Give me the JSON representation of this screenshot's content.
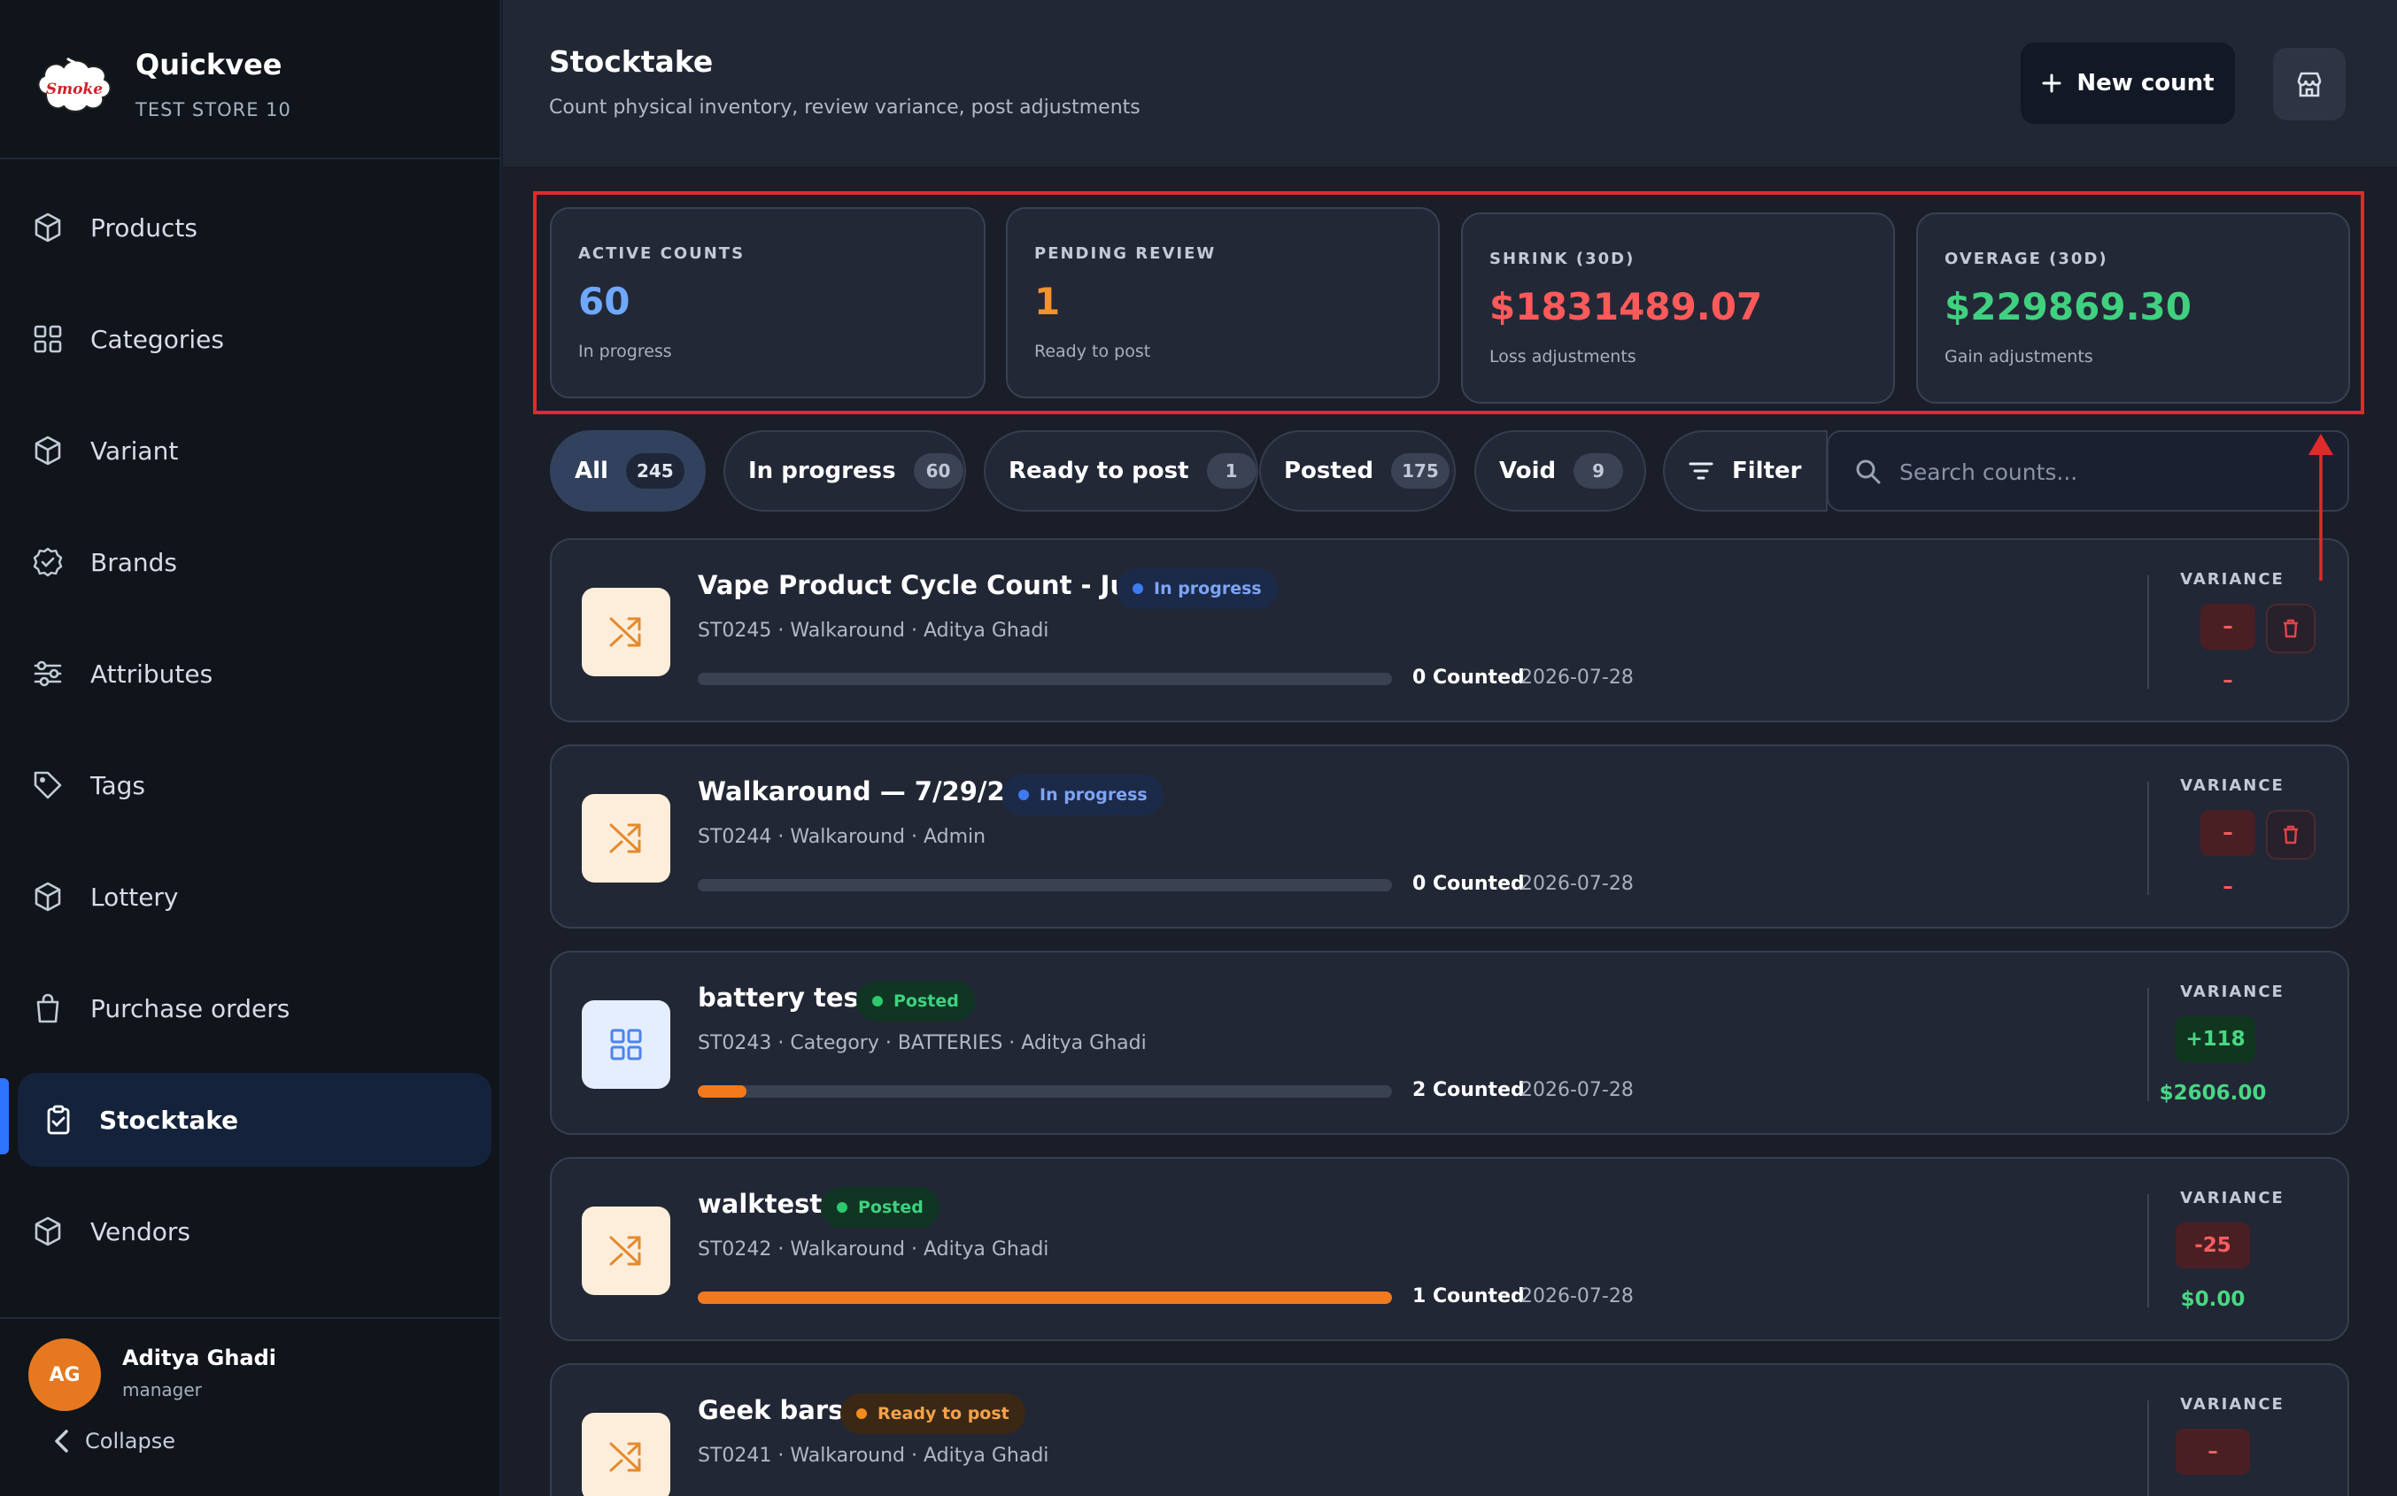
{
  "brand": {
    "name": "Quickvee",
    "store": "TEST STORE 10",
    "logo_text": "Smoke"
  },
  "nav": [
    {
      "label": "Products",
      "icon": "box-icon"
    },
    {
      "label": "Categories",
      "icon": "grid-icon"
    },
    {
      "label": "Variant",
      "icon": "box-icon"
    },
    {
      "label": "Brands",
      "icon": "badge-check-icon"
    },
    {
      "label": "Attributes",
      "icon": "sliders-icon"
    },
    {
      "label": "Tags",
      "icon": "tag-icon"
    },
    {
      "label": "Lottery",
      "icon": "box-icon"
    },
    {
      "label": "Purchase orders",
      "icon": "shopping-bag-icon"
    },
    {
      "label": "Stocktake",
      "icon": "clipboard-check-icon",
      "active": true
    },
    {
      "label": "Vendors",
      "icon": "box-icon"
    }
  ],
  "user": {
    "initials": "AG",
    "name": "Aditya Ghadi",
    "role": "manager",
    "collapse_label": "Collapse"
  },
  "header": {
    "title": "Stocktake",
    "subtitle": "Count physical inventory, review variance, post adjustments",
    "new_count_label": "New count"
  },
  "stats": [
    {
      "label": "ACTIVE COUNTS",
      "value": "60",
      "sub": "In progress",
      "color": "#6ea8ff"
    },
    {
      "label": "PENDING REVIEW",
      "value": "1",
      "sub": "Ready to post",
      "color": "#f5922b"
    },
    {
      "label": "SHRINK (30D)",
      "value": "$1831489.07",
      "sub": "Loss adjustments",
      "color": "#ff5a5a"
    },
    {
      "label": "OVERAGE (30D)",
      "value": "$229869.30",
      "sub": "Gain adjustments",
      "color": "#3fd17f"
    }
  ],
  "filters": {
    "chips": [
      {
        "label": "All",
        "count": "245",
        "active": true
      },
      {
        "label": "In progress",
        "count": "60"
      },
      {
        "label": "Ready to post",
        "count": "1"
      },
      {
        "label": "Posted",
        "count": "175"
      },
      {
        "label": "Void",
        "count": "9"
      }
    ],
    "filter_label": "Filter",
    "search_placeholder": "Search counts..."
  },
  "counts": [
    {
      "title": "Vape Product Cycle Count - July",
      "status": "In progress",
      "status_kind": "inprog",
      "meta": "ST0245 · Walkaround · Aditya Ghadi",
      "progress": 0,
      "counted": "0 Counted",
      "date": "2026-07-28",
      "variance_label": "VARIANCE",
      "variance": "–",
      "amount": "–",
      "icon": "shuffle-icon"
    },
    {
      "title": "Walkaround — 7/29/2026",
      "status": "In progress",
      "status_kind": "inprog",
      "meta": "ST0244 · Walkaround · Admin",
      "progress": 0,
      "counted": "0 Counted",
      "date": "2026-07-28",
      "variance_label": "VARIANCE",
      "variance": "–",
      "amount": "–",
      "icon": "shuffle-icon"
    },
    {
      "title": "battery test",
      "status": "Posted",
      "status_kind": "posted",
      "meta": "ST0243 · Category · BATTERIES · Aditya Ghadi",
      "progress": 0.07,
      "counted": "2 Counted",
      "date": "2026-07-28",
      "variance_label": "VARIANCE",
      "variance": "+118",
      "amount": "$2606.00",
      "icon": "grid-icon"
    },
    {
      "title": "walktest",
      "status": "Posted",
      "status_kind": "posted",
      "meta": "ST0242 · Walkaround · Aditya Ghadi",
      "progress": 1,
      "counted": "1 Counted",
      "date": "2026-07-28",
      "variance_label": "VARIANCE",
      "variance": "-25",
      "amount": "$0.00",
      "icon": "shuffle-icon"
    },
    {
      "title": "Geek bars",
      "status": "Ready to post",
      "status_kind": "ready",
      "meta": "ST0241 · Walkaround · Aditya Ghadi",
      "progress": 0,
      "counted": "",
      "date": "",
      "variance_label": "VARIANCE",
      "variance": "–",
      "amount": "",
      "icon": "shuffle-icon"
    }
  ]
}
